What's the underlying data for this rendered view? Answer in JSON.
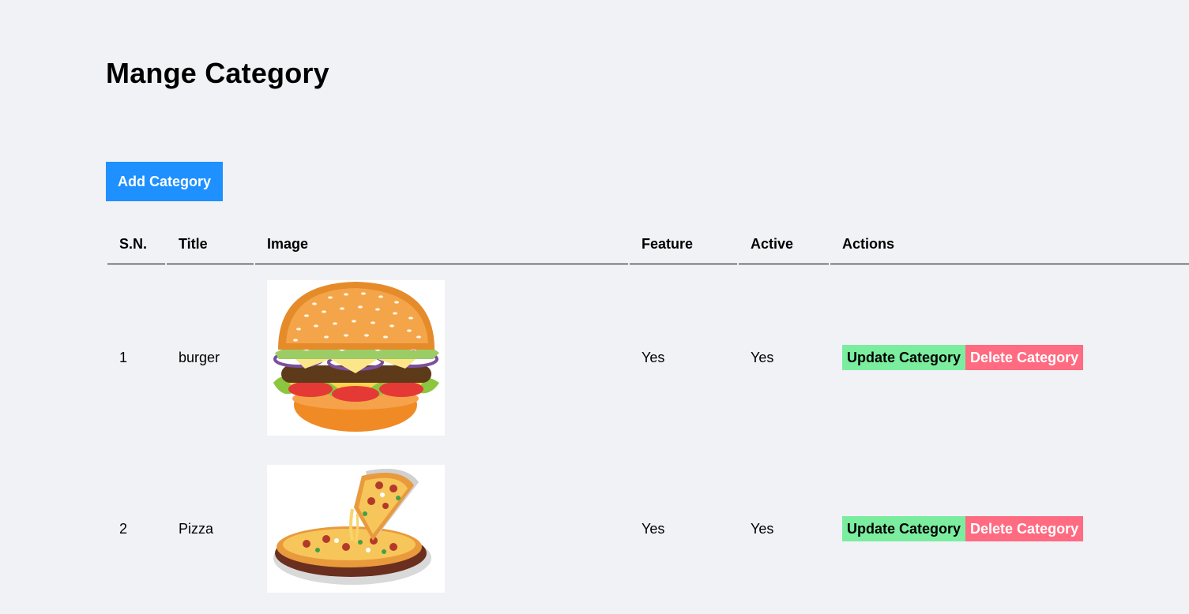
{
  "page": {
    "title": "Mange Category",
    "add_button_label": "Add Category"
  },
  "table": {
    "headers": {
      "sn": "S.N.",
      "title": "Title",
      "image": "Image",
      "feature": "Feature",
      "active": "Active",
      "actions": "Actions"
    },
    "rows": [
      {
        "sn": "1",
        "title": "burger",
        "image": "burger-image",
        "feature": "Yes",
        "active": "Yes",
        "update_label": "Update Category",
        "delete_label": "Delete Category"
      },
      {
        "sn": "2",
        "title": "Pizza",
        "image": "pizza-image",
        "feature": "Yes",
        "active": "Yes",
        "update_label": "Update Category",
        "delete_label": "Delete Category"
      }
    ]
  },
  "colors": {
    "background": "#f1f2f6",
    "add_button": "#1e90ff",
    "update_button": "#7bed9f",
    "delete_button": "#ff6b81"
  }
}
